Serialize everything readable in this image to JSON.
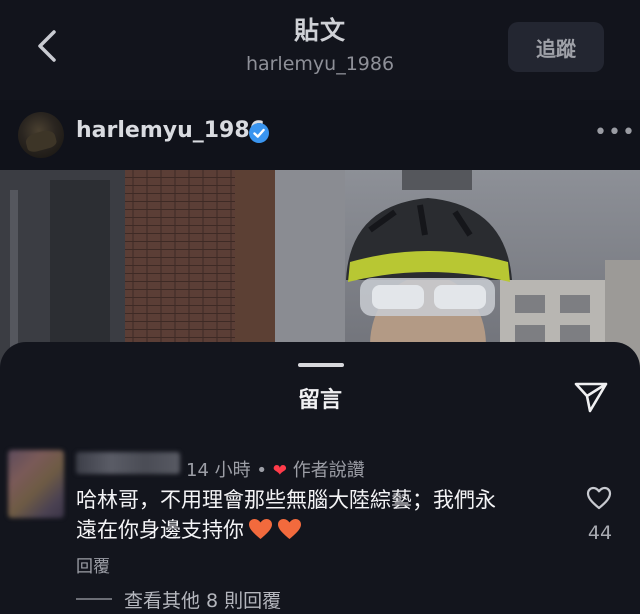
{
  "topbar": {
    "back_icon": "chevron-left-icon",
    "title": "貼文",
    "subtitle": "harlemyu_1986",
    "follow_label": "追蹤"
  },
  "post": {
    "username": "harlemyu_1986",
    "verified_icon": "verified-badge-icon",
    "more_icon": "more-horizontal-icon",
    "more_label": "•••"
  },
  "comments": {
    "title": "留言",
    "share_icon": "send-icon",
    "items": [
      {
        "time": "14 小時",
        "separator": "•",
        "author_liked": "作者說讚",
        "text_line1": "哈林哥，不用理會那些無腦大陸綜藝；我們永",
        "text_line2": "遠在你身邊支持你",
        "reply_label": "回覆",
        "like_count": "44",
        "view_replies": "查看其他 8 則回覆"
      }
    ]
  },
  "colors": {
    "background": "#10121a",
    "sheet": "#13151d",
    "heart": "#ff3b4a",
    "verified": "#3a95f0",
    "emoji_heart": "#f26a3d"
  }
}
